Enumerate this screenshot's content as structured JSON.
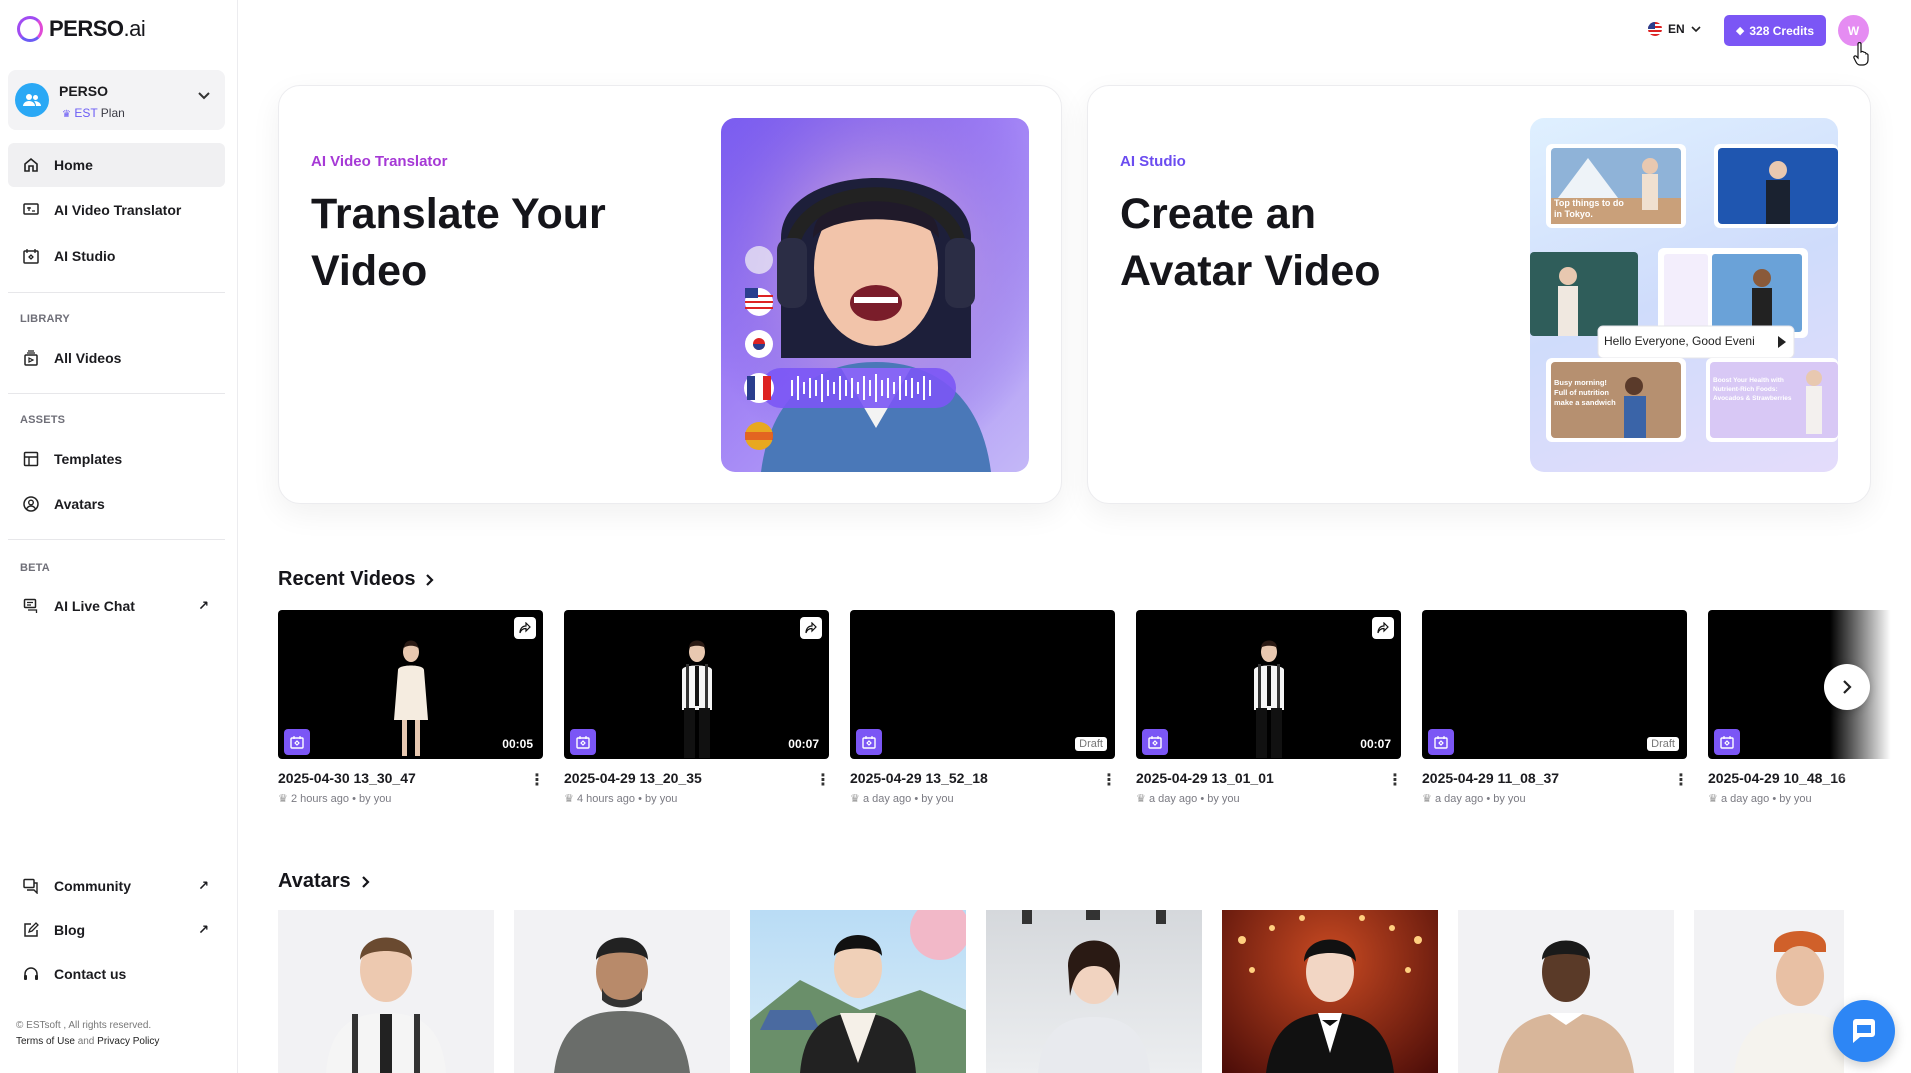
{
  "brand": {
    "name": "PERSO",
    "suffix": ".ai"
  },
  "workspace": {
    "name": "PERSO",
    "plan_tier": "EST",
    "plan_label": "Plan"
  },
  "nav": {
    "home": "Home",
    "translator": "AI Video Translator",
    "studio": "AI Studio",
    "library_section": "LIBRARY",
    "all_videos": "All Videos",
    "assets_section": "ASSETS",
    "templates": "Templates",
    "avatars": "Avatars",
    "beta_section": "BETA",
    "live_chat": "AI Live Chat",
    "community": "Community",
    "blog": "Blog",
    "contact": "Contact us"
  },
  "footer": {
    "copyright": "© ESTsoft , All rights reserved.",
    "terms": "Terms of Use",
    "and": "and",
    "privacy": "Privacy Policy"
  },
  "header": {
    "lang": "EN",
    "credits": "328 Credits",
    "user_initial": "W"
  },
  "hero": {
    "translator": {
      "eyebrow": "AI Video Translator",
      "title": "Translate Your Video",
      "eyebrow_color": "#a639d6"
    },
    "studio": {
      "eyebrow": "AI Studio",
      "title": "Create an Avatar Video",
      "eyebrow_color": "#6b4cf0",
      "speech": "Hello Everyone, Good Eveni",
      "thumb1": "Top things to do  in Tokyo.",
      "thumb2": "Busy morning! Full of nutrition make a sandwich",
      "thumb3": "Boost Your Health with Nutrient-Rich Foods: Avocados & Strawberries"
    }
  },
  "recent": {
    "title": "Recent Videos",
    "videos": [
      {
        "name": "2025-04-30 13_30_47",
        "meta": "2 hours ago",
        "by": "by you",
        "duration": "00:05",
        "draft": ""
      },
      {
        "name": "2025-04-29 13_20_35",
        "meta": "4 hours ago",
        "by": "by you",
        "duration": "00:07",
        "draft": ""
      },
      {
        "name": "2025-04-29 13_52_18",
        "meta": "a day ago",
        "by": "by you",
        "duration": "",
        "draft": "Draft"
      },
      {
        "name": "2025-04-29 13_01_01",
        "meta": "a day ago",
        "by": "by you",
        "duration": "00:07",
        "draft": ""
      },
      {
        "name": "2025-04-29 11_08_37",
        "meta": "a day ago",
        "by": "by you",
        "duration": "",
        "draft": "Draft"
      },
      {
        "name": "2025-04-29 10_48_16",
        "meta": "a day ago",
        "by": "by you",
        "duration": "",
        "draft": ""
      }
    ]
  },
  "avatars_section": {
    "title": "Avatars"
  },
  "colors": {
    "accent": "#7b56f5",
    "chat": "#2d86f5"
  }
}
